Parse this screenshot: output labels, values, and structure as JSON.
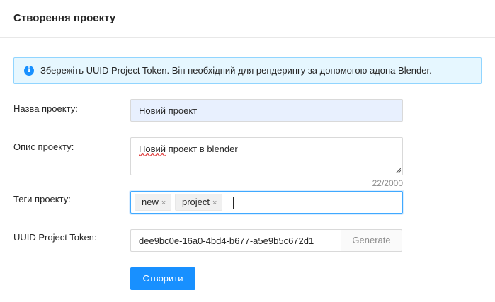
{
  "header": {
    "title": "Створення проекту"
  },
  "alert": {
    "icon": "info-icon",
    "text": "Збережіть UUID Project Token. Він необхідний для рендерингу за допомогою адона Blender."
  },
  "form": {
    "name": {
      "label": "Назва проекту:",
      "value": "Новий проект"
    },
    "description": {
      "label": "Опис проекту:",
      "value_first_word": "Новий",
      "value_rest": " проект в blender",
      "counter": "22/2000"
    },
    "tags": {
      "label": "Теги проекту:",
      "items": [
        {
          "label": "new",
          "remove": "×"
        },
        {
          "label": "project",
          "remove": "×"
        }
      ]
    },
    "token": {
      "label": "UUID Project Token:",
      "value": "dee9bc0e-16a0-4bd4-b677-a5e9b5c672d1",
      "generate_label": "Generate"
    },
    "submit_label": "Створити"
  },
  "colors": {
    "primary": "#1890ff",
    "alert_bg": "#e6f7ff",
    "autofill_bg": "#e8f0fe"
  }
}
